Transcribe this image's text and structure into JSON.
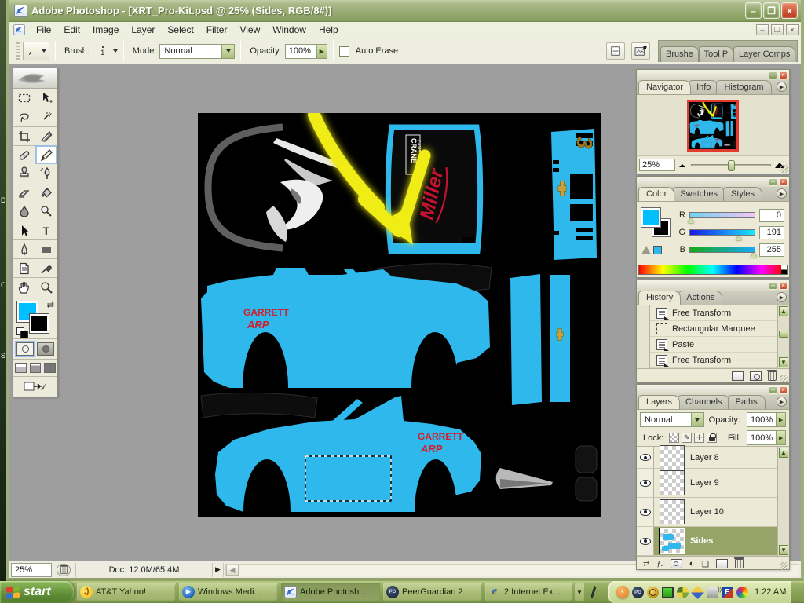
{
  "window": {
    "title": "Adobe Photoshop - [XRT_Pro-Kit.psd @ 25% (Sides, RGB/8#)]",
    "minimize": "–",
    "maximize": "❐",
    "close": "×",
    "doc_minimize": "–",
    "doc_restore": "❐",
    "doc_close": "×"
  },
  "menubar": {
    "items": [
      "File",
      "Edit",
      "Image",
      "Layer",
      "Select",
      "Filter",
      "View",
      "Window",
      "Help"
    ]
  },
  "options": {
    "brush_label": "Brush:",
    "brush_size": "1",
    "mode_label": "Mode:",
    "mode_value": "Normal",
    "opacity_label": "Opacity:",
    "opacity_value": "100%",
    "auto_erase_label": "Auto Erase",
    "well_tabs": [
      "Brushe",
      "Tool P",
      "Layer Comps"
    ]
  },
  "canvas": {
    "number": "3",
    "crane_line1": "CRANE",
    "crane_line2": "CAMS",
    "miller": "Miller",
    "garrett": "GARRETT",
    "arp": "ARP"
  },
  "navigator": {
    "tabs": [
      "Navigator",
      "Info",
      "Histogram"
    ],
    "zoom": "25%"
  },
  "color": {
    "tabs": [
      "Color",
      "Swatches",
      "Styles"
    ],
    "channels": [
      {
        "label": "R",
        "value": "0"
      },
      {
        "label": "G",
        "value": "191"
      },
      {
        "label": "B",
        "value": "255"
      }
    ]
  },
  "history": {
    "tabs": [
      "History",
      "Actions"
    ],
    "items": [
      "Free Transform",
      "Rectangular Marquee",
      "Paste",
      "Free Transform"
    ]
  },
  "layers": {
    "tabs": [
      "Layers",
      "Channels",
      "Paths"
    ],
    "blend_mode": "Normal",
    "opacity_label": "Opacity:",
    "opacity_value": "100%",
    "lock_label": "Lock:",
    "fill_label": "Fill:",
    "fill_value": "100%",
    "items": [
      "Layer 8",
      "Layer 9",
      "Layer 10",
      "Sides"
    ]
  },
  "status": {
    "zoom": "25%",
    "doc": "Doc: 12.0M/65.4M"
  },
  "taskbar": {
    "start": "start",
    "tasks": [
      "AT&T Yahoo! ...",
      "Windows Medi...",
      "Adobe Photosh...",
      "PeerGuardian 2",
      "2 Internet Ex..."
    ],
    "clock": "1:22 AM"
  },
  "colors": {
    "foreground": "#00BFFF",
    "canvas_blue": "#2FB8EC",
    "logo_red": "#C41230"
  }
}
